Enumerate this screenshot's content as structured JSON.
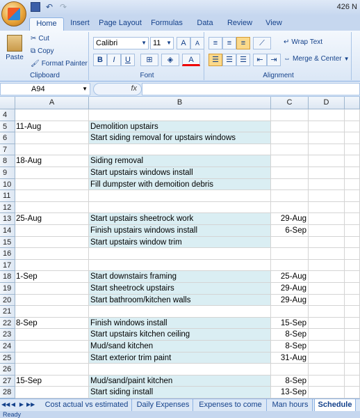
{
  "window": {
    "title": "426 N"
  },
  "ribbon_tabs": [
    "Home",
    "Insert",
    "Page Layout",
    "Formulas",
    "Data",
    "Review",
    "View"
  ],
  "clipboard": {
    "paste": "Paste",
    "cut": "Cut",
    "copy": "Copy",
    "format_painter": "Format Painter",
    "label": "Clipboard"
  },
  "font": {
    "name": "Calibri",
    "size": "11",
    "label": "Font",
    "bold": "B",
    "italic": "I",
    "underline": "U"
  },
  "alignment": {
    "wrap_text": "Wrap Text",
    "merge_center": "Merge & Center",
    "label": "Alignment"
  },
  "formula_bar": {
    "name_box": "A94",
    "fx": "fx"
  },
  "columns": [
    "A",
    "B",
    "C",
    "D"
  ],
  "rows": [
    {
      "num": "4",
      "a": "",
      "b": "",
      "c": ""
    },
    {
      "num": "5",
      "a": "11-Aug",
      "b": "Demolition upstairs",
      "c": ""
    },
    {
      "num": "6",
      "a": "",
      "b": "Start siding removal for upstairs windows",
      "c": ""
    },
    {
      "num": "7",
      "a": "",
      "b": "",
      "c": ""
    },
    {
      "num": "8",
      "a": "18-Aug",
      "b": "Siding removal",
      "c": ""
    },
    {
      "num": "9",
      "a": "",
      "b": "Start upstairs windows install",
      "c": ""
    },
    {
      "num": "10",
      "a": "",
      "b": "Fill dumpster with demoition debris",
      "c": ""
    },
    {
      "num": "11",
      "a": "",
      "b": "",
      "c": ""
    },
    {
      "num": "12",
      "a": "",
      "b": "",
      "c": ""
    },
    {
      "num": "13",
      "a": "25-Aug",
      "b": "Start upstairs sheetrock work",
      "c": "29-Aug"
    },
    {
      "num": "14",
      "a": "",
      "b": "Finish upstairs windows install",
      "c": "6-Sep"
    },
    {
      "num": "15",
      "a": "",
      "b": "Start upstairs window trim",
      "c": ""
    },
    {
      "num": "16",
      "a": "",
      "b": "",
      "c": ""
    },
    {
      "num": "17",
      "a": "",
      "b": "",
      "c": ""
    },
    {
      "num": "18",
      "a": "1-Sep",
      "b": "Start downstairs framing",
      "c": "25-Aug"
    },
    {
      "num": "19",
      "a": "",
      "b": "Start sheetrock upstairs",
      "c": "29-Aug"
    },
    {
      "num": "20",
      "a": "",
      "b": "Start bathroom/kitchen walls",
      "c": "29-Aug"
    },
    {
      "num": "21",
      "a": "",
      "b": "",
      "c": ""
    },
    {
      "num": "22",
      "a": "8-Sep",
      "b": "Finish windows install",
      "c": "15-Sep"
    },
    {
      "num": "23",
      "a": "",
      "b": "Start upstairs kitchen ceiling",
      "c": "8-Sep"
    },
    {
      "num": "24",
      "a": "",
      "b": "Mud/sand kitchen",
      "c": "8-Sep"
    },
    {
      "num": "25",
      "a": "",
      "b": "Start exterior trim paint",
      "c": "31-Aug"
    },
    {
      "num": "26",
      "a": "",
      "b": "",
      "c": ""
    },
    {
      "num": "27",
      "a": "15-Sep",
      "b": "Mud/sand/paint kitchen",
      "c": "8-Sep"
    },
    {
      "num": "28",
      "a": "",
      "b": "Start siding install",
      "c": "13-Sep"
    }
  ],
  "sheet_tabs": [
    "Cost actual vs estimated",
    "Daily Expenses",
    "Expenses to come",
    "Man hours",
    "Schedule"
  ],
  "active_sheet": "Schedule",
  "status": "Ready",
  "colors": {
    "highlight": "#daeef3",
    "ribbon": "#dbe7f6"
  }
}
